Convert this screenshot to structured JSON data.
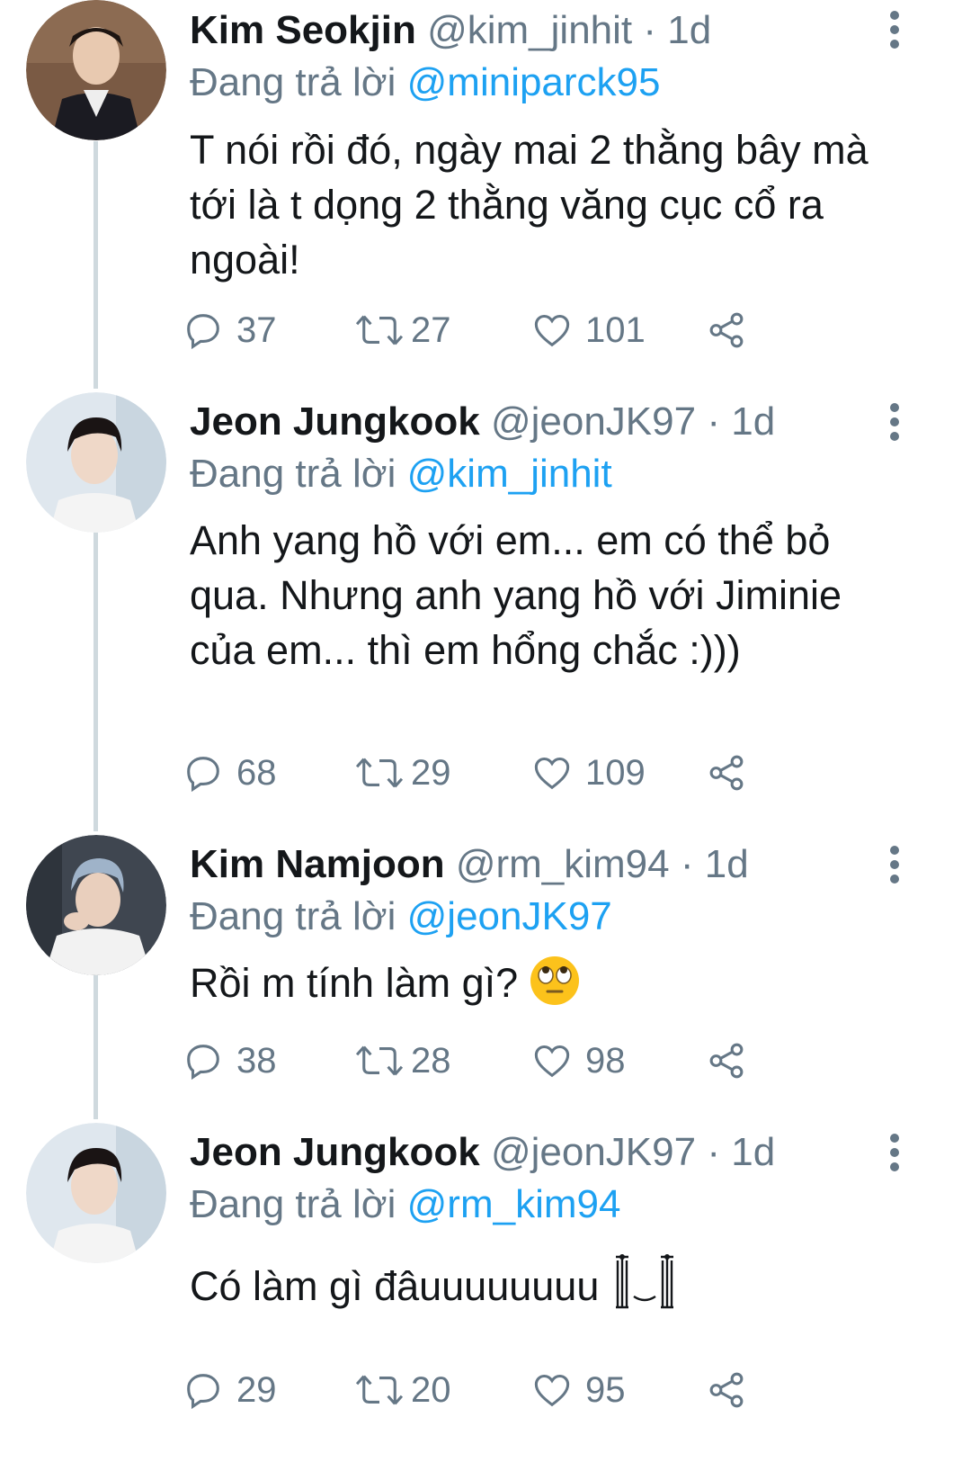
{
  "colors": {
    "text": "#14171a",
    "muted": "#657786",
    "link": "#1da1f2",
    "thread": "#cfd9de"
  },
  "tweets": [
    {
      "name": "Kim Seokjin",
      "handle": "@kim_jinhit",
      "separator": "·",
      "time": "1d",
      "reply_prefix": "Đang trả lời",
      "reply_to": "@miniparck95",
      "text": "T nói rồi đó, ngày mai 2 thằng bây mà tới là t dọng 2 thằng văng cục cổ ra ngoài!",
      "replies": "37",
      "retweets": "27",
      "likes": "101"
    },
    {
      "name": "Jeon Jungkook",
      "handle": "@jeonJK97",
      "separator": "·",
      "time": "1d",
      "reply_prefix": "Đang trả lời",
      "reply_to": "@kim_jinhit",
      "text": "Anh yang hồ với em... em có thể bỏ qua. Nhưng anh yang hồ với Jiminie của em... thì em hổng chắc :)))",
      "replies": "68",
      "retweets": "29",
      "likes": "109"
    },
    {
      "name": "Kim Namjoon",
      "handle": "@rm_kim94",
      "separator": "·",
      "time": "1d",
      "reply_prefix": "Đang trả lời",
      "reply_to": "@jeonJK97",
      "text": "Rồi m tính làm gì?",
      "replies": "38",
      "retweets": "28",
      "likes": "98"
    },
    {
      "name": "Jeon Jungkook",
      "handle": "@jeonJK97",
      "separator": "·",
      "time": "1d",
      "reply_prefix": "Đang trả lời",
      "reply_to": "@rm_kim94",
      "text": "Có làm gì đâuuuuuuuu",
      "replies": "29",
      "retweets": "20",
      "likes": "95"
    }
  ]
}
